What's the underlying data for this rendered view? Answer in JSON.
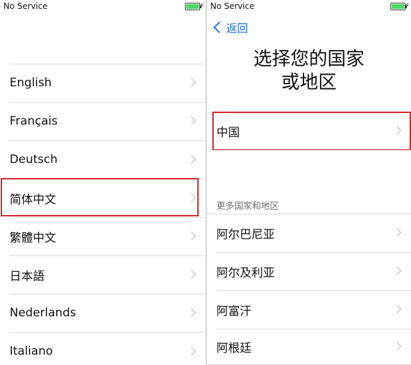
{
  "left_screen": {
    "status": {
      "carrier": "No Service",
      "charging_symbol": "⚡"
    },
    "languages": [
      {
        "label": "English",
        "selected": false
      },
      {
        "label": "Français",
        "selected": false
      },
      {
        "label": "Deutsch",
        "selected": false
      },
      {
        "label": "简体中文",
        "selected": true
      },
      {
        "label": "繁體中文",
        "selected": false
      },
      {
        "label": "日本語",
        "selected": false
      },
      {
        "label": "Nederlands",
        "selected": false
      },
      {
        "label": "Italiano",
        "selected": false
      }
    ]
  },
  "right_screen": {
    "status": {
      "carrier": "No Service",
      "charging_symbol": "⚡"
    },
    "back_label": "返回",
    "title_line1": "选择您的国家",
    "title_line2": "或地区",
    "top_country": {
      "label": "中国",
      "selected": true
    },
    "more_header": "更多国家和地区",
    "countries": [
      {
        "label": "阿尔巴尼亚"
      },
      {
        "label": "阿尔及利亚"
      },
      {
        "label": "阿富汗"
      },
      {
        "label": "阿根廷"
      }
    ]
  },
  "colors": {
    "highlight": "#d42525",
    "accent": "#1a73d9",
    "battery": "#4cd964"
  }
}
